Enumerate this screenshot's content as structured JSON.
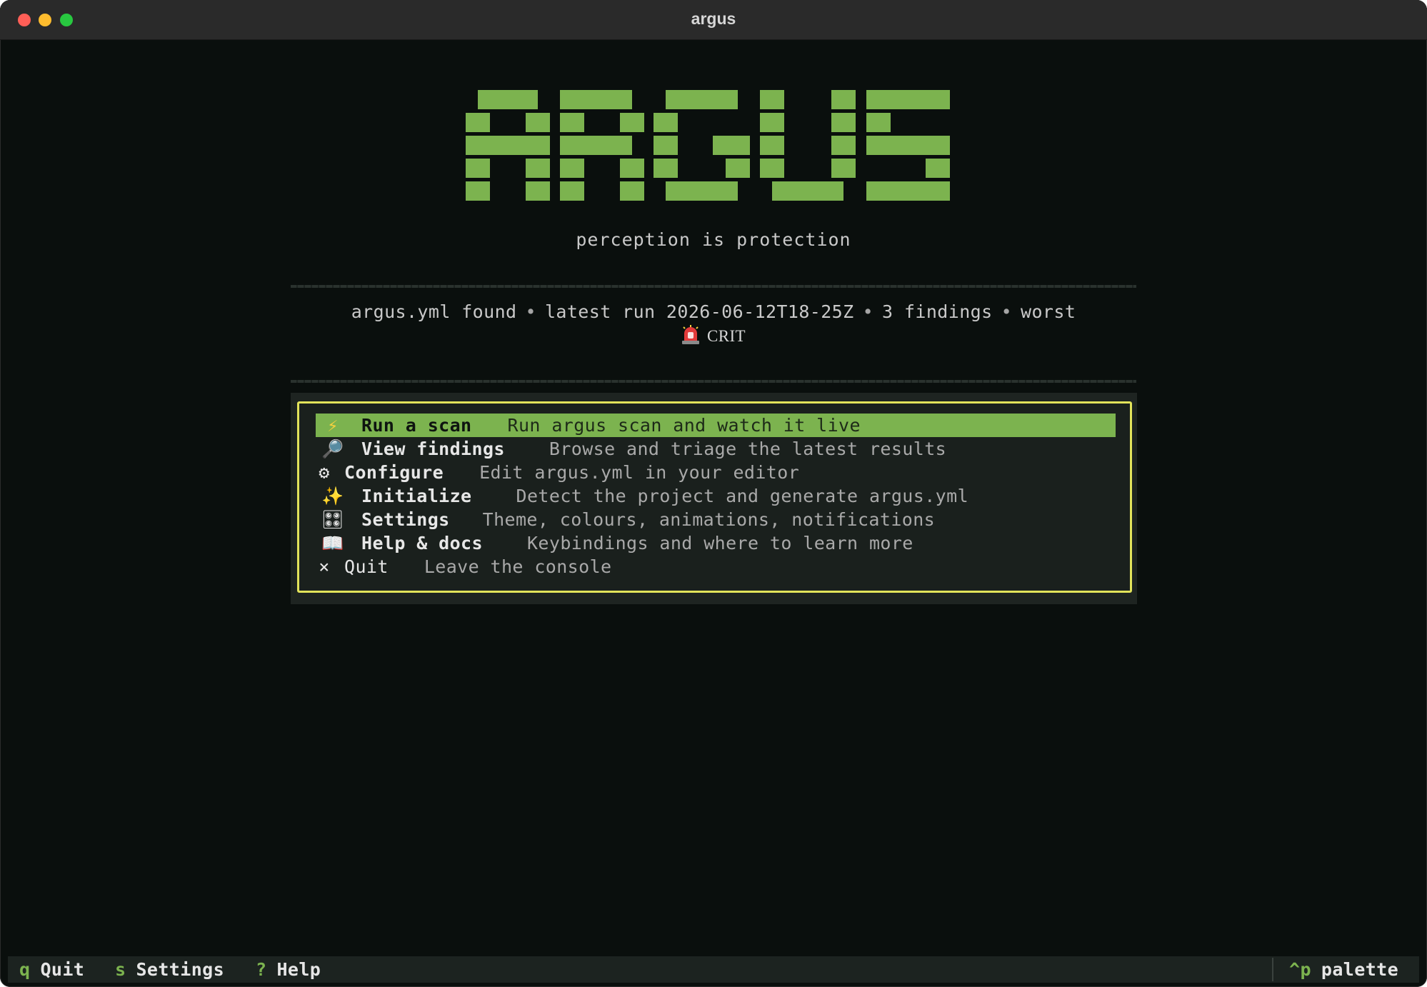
{
  "window": {
    "title": "argus"
  },
  "logo": {
    "text": "ARGUS",
    "color": "#7cb34f"
  },
  "tagline": "perception is protection",
  "status": {
    "config": "argus.yml found",
    "separator": "•",
    "latest_run_label": "latest run 2026-06-12T18-25Z",
    "findings": "3 findings",
    "worst_label": "worst",
    "worst_level": "CRIT",
    "worst_icon": "siren-icon"
  },
  "menu": {
    "items": [
      {
        "icon": "⚡",
        "icon_name": "lightning-icon",
        "label": "Run a scan",
        "description": "Run argus scan and watch it live",
        "selected": true
      },
      {
        "icon": "🔎",
        "icon_name": "magnifier-icon",
        "label": "View findings",
        "description": "Browse and triage the latest results"
      },
      {
        "icon": "⚙",
        "icon_name": "gear-icon",
        "label": "Configure",
        "description": "Edit argus.yml in your editor"
      },
      {
        "icon": "✨",
        "icon_name": "sparkles-icon",
        "label": "Initialize",
        "description": "Detect the project and generate argus.yml"
      },
      {
        "icon": "🎛",
        "icon_name": "control-knobs-icon",
        "label": "Settings",
        "description": "Theme, colours, animations, notifications"
      },
      {
        "icon": "📖",
        "icon_name": "book-icon",
        "label": "Help & docs",
        "description": "Keybindings and where to learn more"
      },
      {
        "icon": "×",
        "icon_name": "close-icon",
        "label": "Quit",
        "description": "Leave the console"
      }
    ],
    "border_color": "#e2e35a",
    "highlight_color": "#7cb34f"
  },
  "footer": {
    "bindings": [
      {
        "key": "q",
        "label": "Quit"
      },
      {
        "key": "s",
        "label": "Settings"
      },
      {
        "key": "?",
        "label": "Help"
      }
    ],
    "palette": {
      "key": "^p",
      "label": "palette"
    }
  }
}
